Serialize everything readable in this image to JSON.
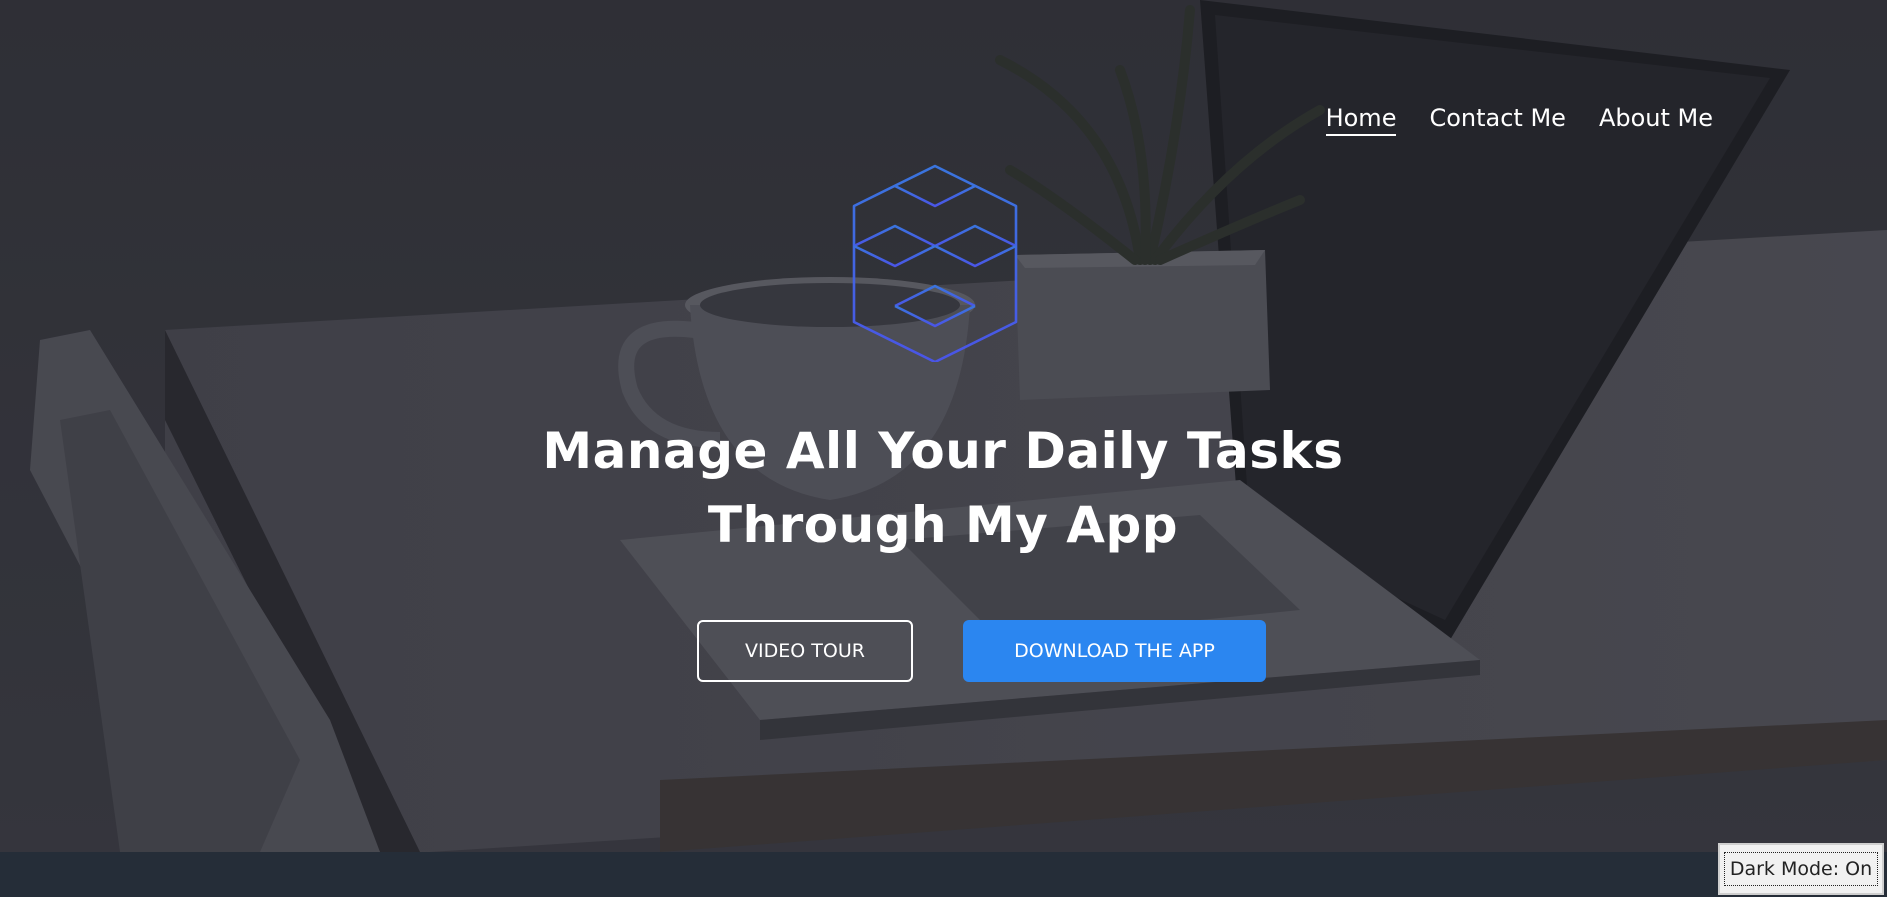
{
  "nav": {
    "items": [
      {
        "label": "Home",
        "active": true
      },
      {
        "label": "Contact Me",
        "active": false
      },
      {
        "label": "About Me",
        "active": false
      }
    ]
  },
  "logo": {
    "icon": "cube-stack-icon",
    "color": "#3f5fe0"
  },
  "hero": {
    "headline_line1": "Manage All Your Daily Tasks",
    "headline_line2": "Through My App"
  },
  "buttons": {
    "video_tour": "Video Tour",
    "download": "Download the App"
  },
  "dark_mode_toggle": {
    "label": "Dark Mode: On"
  },
  "colors": {
    "accent": "#2b86f0",
    "overlay": "#2e3038",
    "footer": "#252d38"
  }
}
